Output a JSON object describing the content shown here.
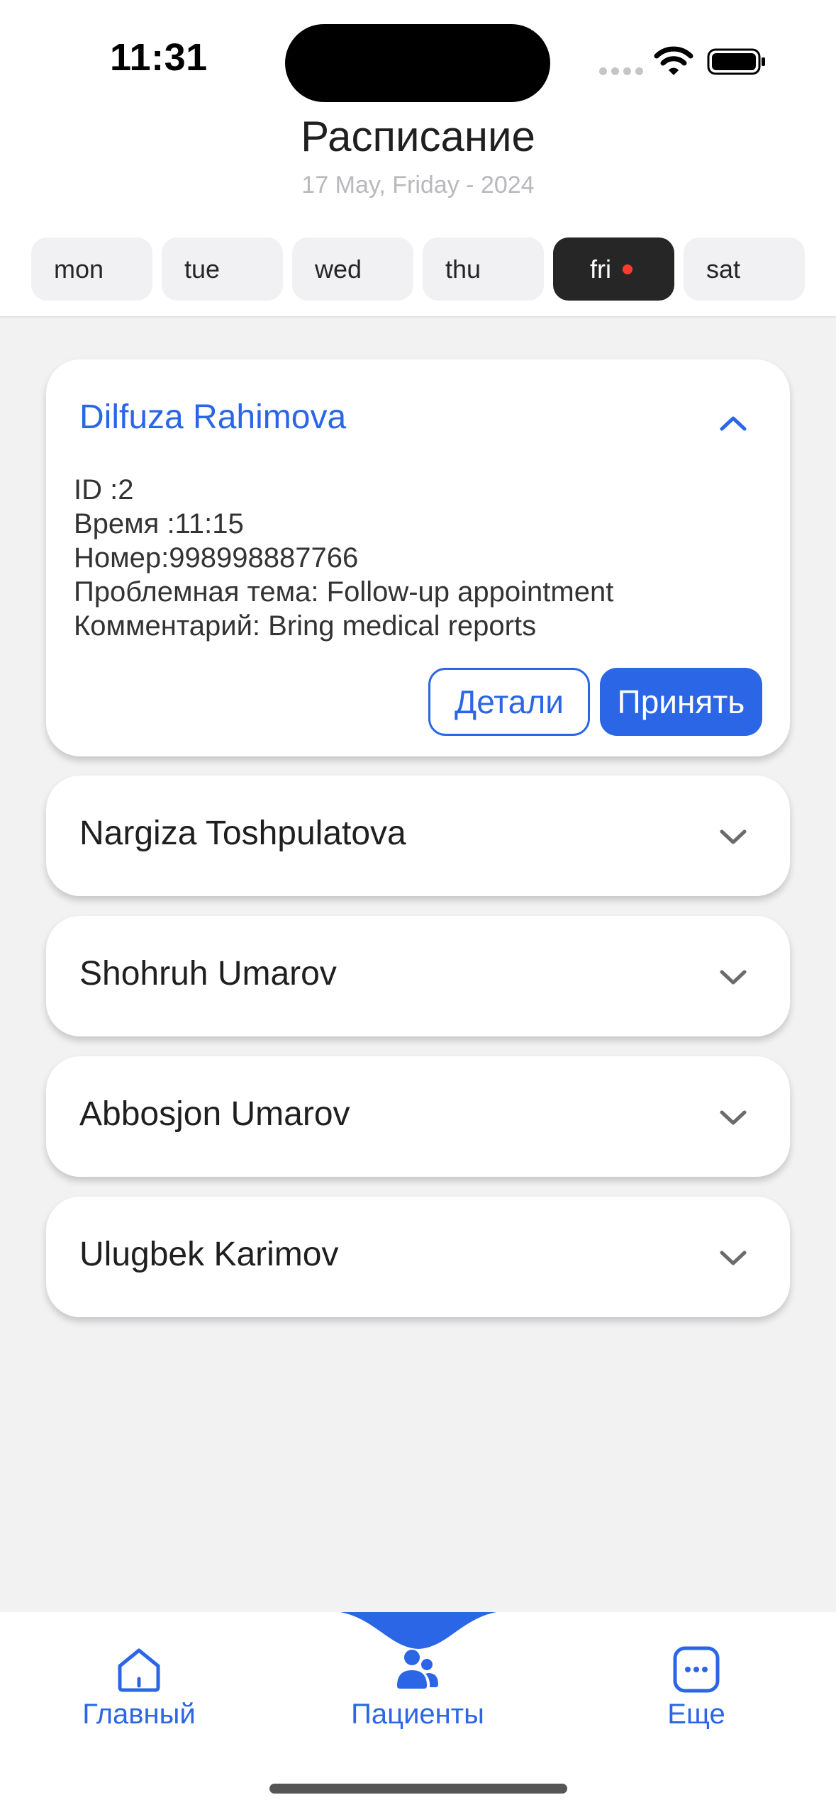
{
  "status_bar": {
    "time": "11:31"
  },
  "header": {
    "title": "Расписание",
    "subtitle": "17 May, Friday - 2024"
  },
  "days": [
    {
      "label": "mon",
      "active": false
    },
    {
      "label": "tue",
      "active": false
    },
    {
      "label": "wed",
      "active": false
    },
    {
      "label": "thu",
      "active": false
    },
    {
      "label": "fri",
      "active": true
    },
    {
      "label": "sat",
      "active": false
    }
  ],
  "appointments": [
    {
      "name": "Dilfuza Rahimova",
      "expanded": true,
      "lines": [
        "ID :2",
        "Время :11:15",
        "Номер:998998887766",
        "Проблемная тема: Follow-up appointment",
        "Комментарий: Bring medical reports"
      ],
      "details_label": "Детали",
      "accept_label": "Принять"
    },
    {
      "name": "Nargiza Toshpulatova",
      "expanded": false
    },
    {
      "name": "Shohruh Umarov",
      "expanded": false
    },
    {
      "name": "Abbosjon Umarov",
      "expanded": false
    },
    {
      "name": "Ulugbek Karimov",
      "expanded": false
    }
  ],
  "bottom_nav": {
    "items": [
      {
        "label": "Главный",
        "icon": "home-icon"
      },
      {
        "label": "Пациенты",
        "icon": "patients-icon"
      },
      {
        "label": "Еще",
        "icon": "more-icon"
      }
    ]
  },
  "colors": {
    "accent": "#2b66e6",
    "active_tab": "#262626",
    "notification_dot": "#ff3b30"
  }
}
